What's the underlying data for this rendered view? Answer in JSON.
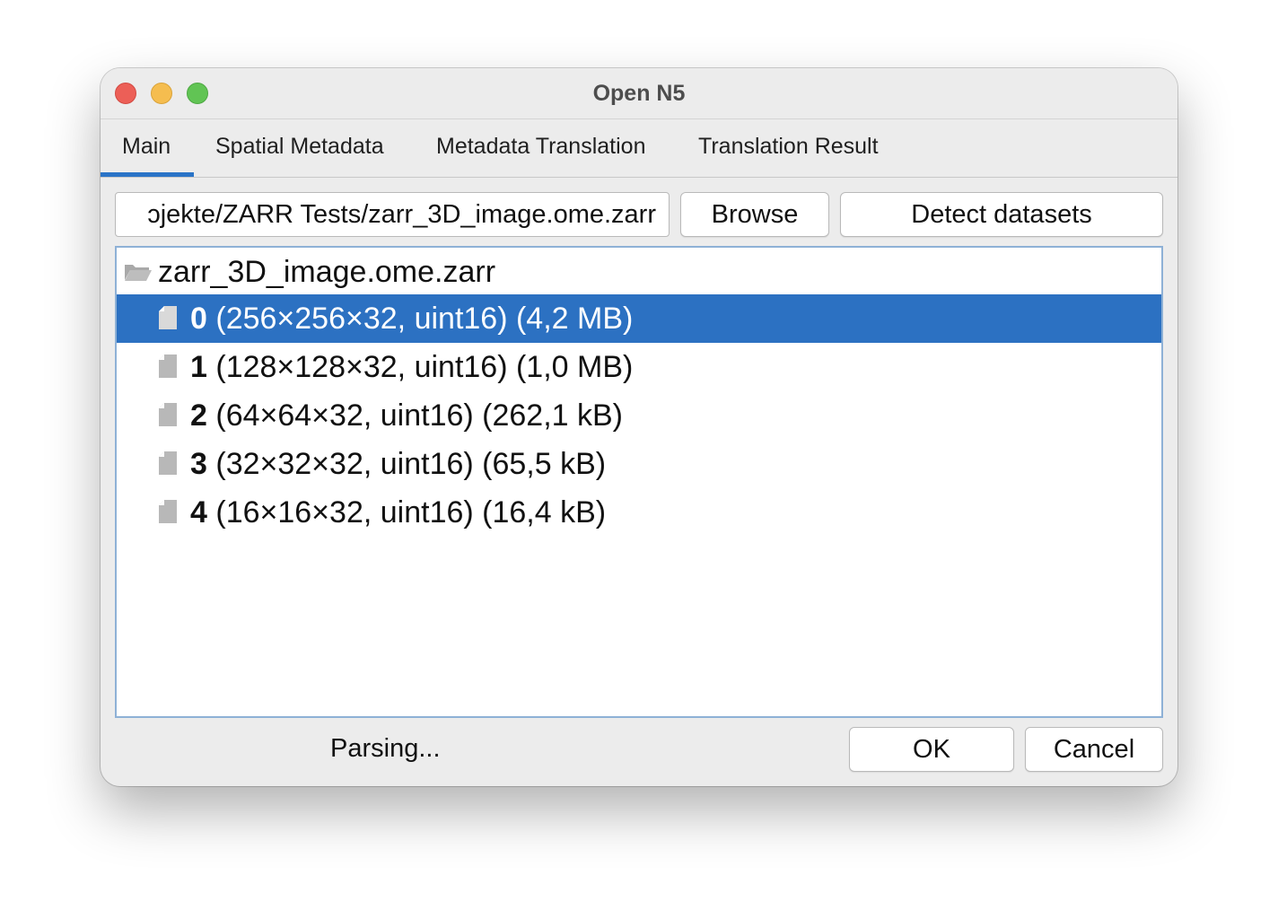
{
  "window": {
    "title": "Open N5"
  },
  "tabs": [
    {
      "label": "Main",
      "active": true
    },
    {
      "label": "Spatial Metadata",
      "active": false
    },
    {
      "label": "Metadata Translation",
      "active": false
    },
    {
      "label": "Translation Result",
      "active": false
    }
  ],
  "path": {
    "value_visible": "ɔjekte/ZARR Tests/zarr_3D_image.ome.zarr"
  },
  "buttons": {
    "browse": "Browse",
    "detect": "Detect datasets",
    "ok": "OK",
    "cancel": "Cancel"
  },
  "tree": {
    "root": {
      "label": "zarr_3D_image.ome.zarr",
      "icon": "folder-open-icon"
    },
    "items": [
      {
        "index": "0",
        "details": " (256×256×32, uint16) (4,2 MB)",
        "selected": true,
        "icon": "file-icon"
      },
      {
        "index": "1",
        "details": " (128×128×32, uint16) (1,0 MB)",
        "selected": false,
        "icon": "file-icon"
      },
      {
        "index": "2",
        "details": " (64×64×32, uint16) (262,1 kB)",
        "selected": false,
        "icon": "file-icon"
      },
      {
        "index": "3",
        "details": " (32×32×32, uint16) (65,5 kB)",
        "selected": false,
        "icon": "file-icon"
      },
      {
        "index": "4",
        "details": " (16×16×32, uint16) (16,4 kB)",
        "selected": false,
        "icon": "file-icon"
      }
    ]
  },
  "status": "Parsing...",
  "colors": {
    "accent": "#2c71c2",
    "close": "#ec5f57",
    "minimize": "#f5bd4f",
    "maximize": "#61c454"
  }
}
